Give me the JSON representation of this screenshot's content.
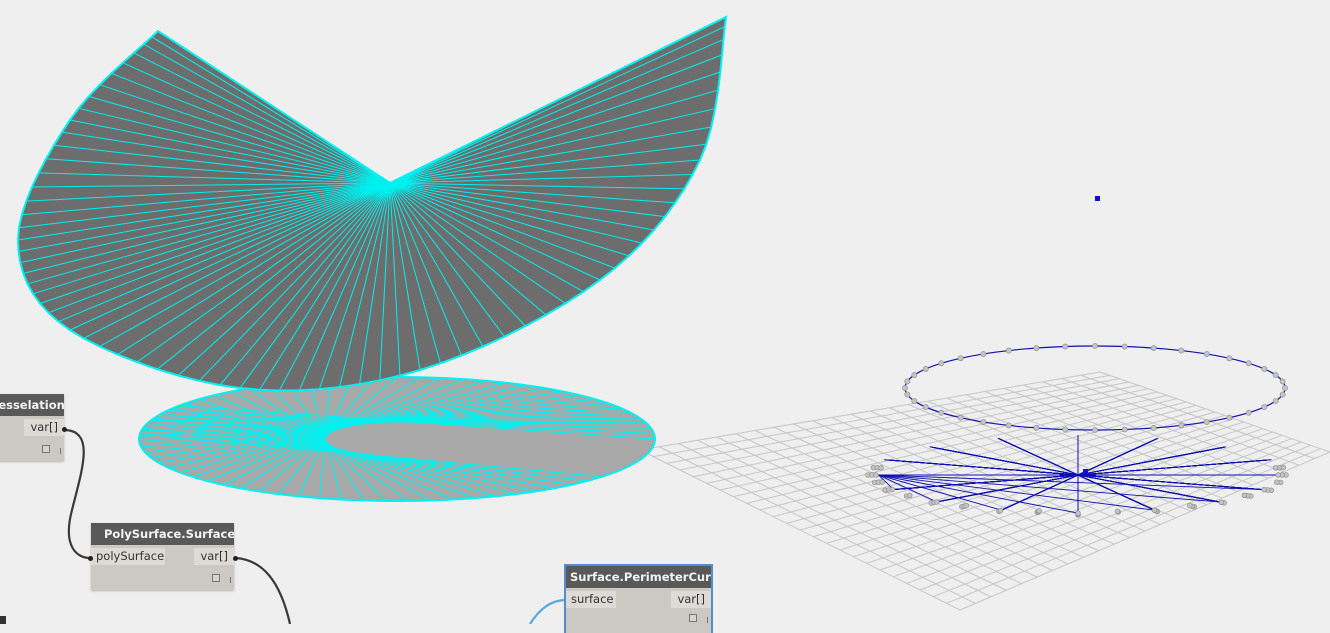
{
  "window": {
    "app_view": "dynamo-graph-canvas"
  },
  "colors": {
    "canvas_background": "#efefef",
    "node_header": "#595959",
    "node_body": "#ccc8c2",
    "port_background": "#dedbd6",
    "wire_dark": "#3a3a3a",
    "wire_selected": "#5aa9d6",
    "surface_fill": "#6d6d6d",
    "surface_edge": "#00f0f0",
    "disc_fill": "#a8a8a8",
    "grid_line": "#c6c6c6",
    "curve_line": "#1010b0",
    "point_fill": "#c4c4c4",
    "selection_outline": "#4e8fd0"
  },
  "nodes": {
    "tesselation": {
      "title": "Tesselation",
      "output_port": "var[]",
      "preview_icon": "preview-toggle-icon"
    },
    "polysurface_surfaces": {
      "title": "PolySurface.Surfaces",
      "input_port": "polySurface",
      "output_port": "var[]",
      "preview_icon": "preview-toggle-icon"
    },
    "surface_perimeter_curves": {
      "title": "Surface.PerimeterCurves",
      "input_port": "surface",
      "output_port": "var[]",
      "preview_icon": "preview-toggle-icon",
      "selected": true
    }
  },
  "geometry": {
    "fan_surface_segments": 72,
    "disc_surface_segments": 36,
    "helix_turns": 8,
    "points_per_turn": 32
  }
}
